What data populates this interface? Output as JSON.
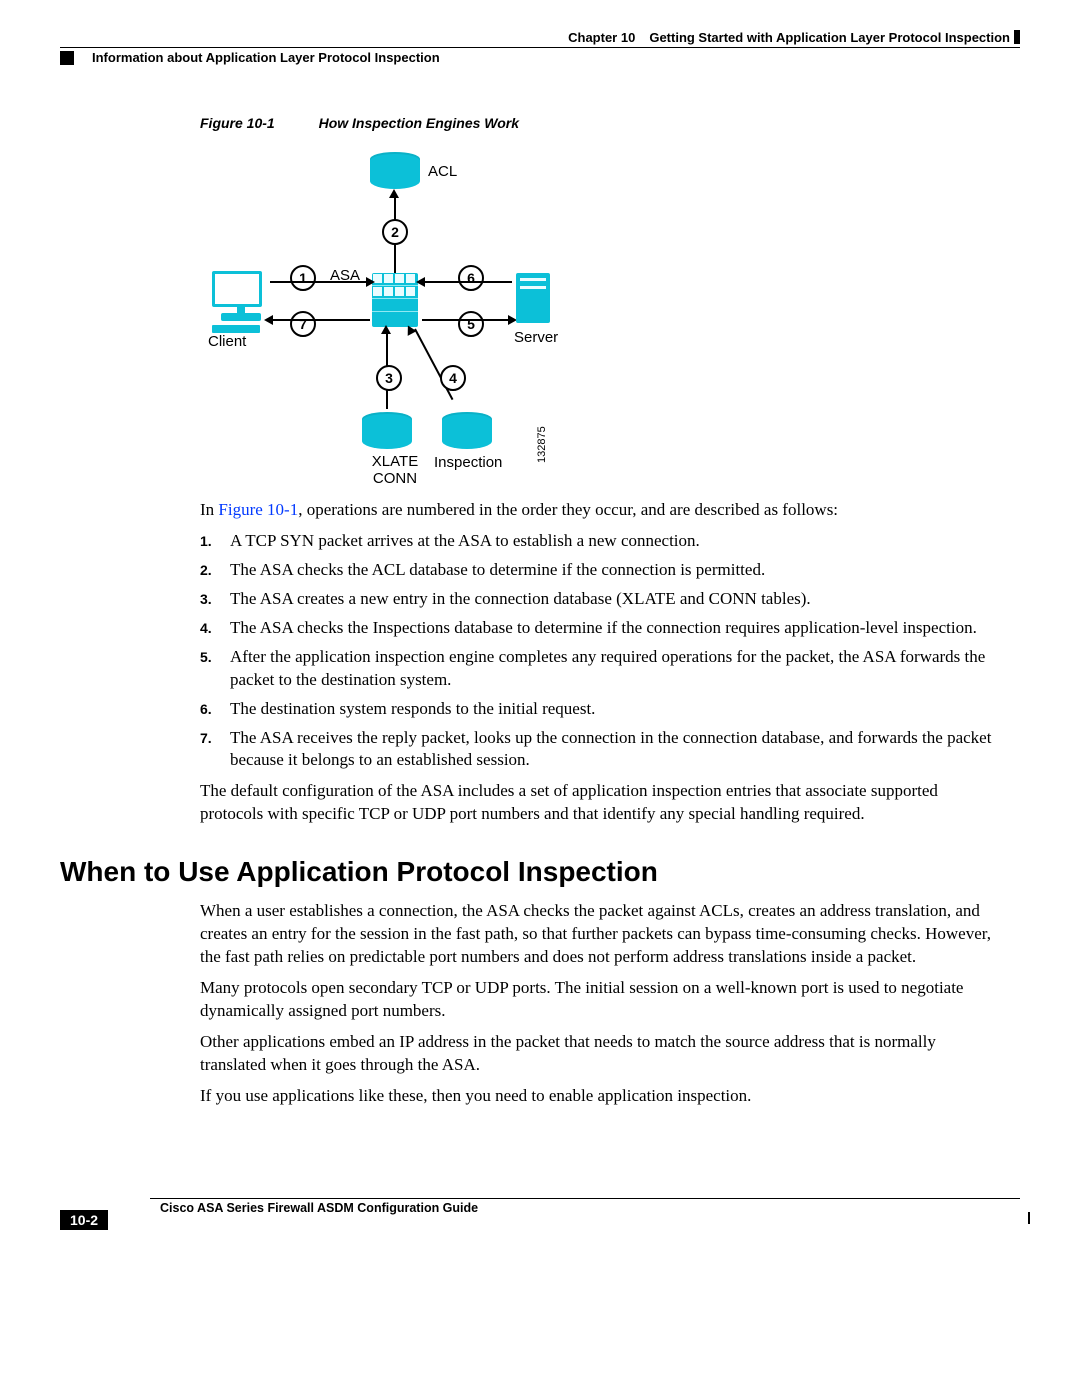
{
  "header": {
    "chapter_label": "Chapter 10",
    "chapter_title": "Getting Started with Application Layer Protocol Inspection",
    "section_header": "Information about Application Layer Protocol Inspection"
  },
  "figure": {
    "label": "Figure 10-1",
    "title": "How Inspection Engines Work",
    "labels": {
      "acl": "ACL",
      "asa": "ASA",
      "client": "Client",
      "server": "Server",
      "xlate_conn": "XLATE CONN",
      "inspection": "Inspection"
    },
    "steps": {
      "s1": "1",
      "s2": "2",
      "s3": "3",
      "s4": "4",
      "s5": "5",
      "s6": "6",
      "s7": "7"
    },
    "image_number": "132875"
  },
  "intro_sentence_prefix": "In ",
  "intro_sentence_ref": "Figure 10-1",
  "intro_sentence_suffix": ", operations are numbered in the order they occur, and are described as follows:",
  "steps_list": [
    {
      "n": "1.",
      "t": "A TCP SYN packet arrives at the ASA to establish a new connection."
    },
    {
      "n": "2.",
      "t": "The ASA checks the ACL database to determine if the connection is permitted."
    },
    {
      "n": "3.",
      "t": "The ASA creates a new entry in the connection database (XLATE and CONN tables)."
    },
    {
      "n": "4.",
      "t": "The ASA checks the Inspections database to determine if the connection requires application-level inspection."
    },
    {
      "n": "5.",
      "t": "After the application inspection engine completes any required operations for the packet, the ASA forwards the packet to the destination system."
    },
    {
      "n": "6.",
      "t": "The destination system responds to the initial request."
    },
    {
      "n": "7.",
      "t": "The ASA receives the reply packet, looks up the connection in the connection database, and forwards the packet because it belongs to an established session."
    }
  ],
  "after_steps_paragraph": "The default configuration of the ASA includes a set of application inspection entries that associate supported protocols with specific TCP or UDP port numbers and that identify any special handling required.",
  "section_heading": "When to Use Application Protocol Inspection",
  "section_paragraphs": [
    "When a user establishes a connection, the ASA checks the packet against ACLs, creates an address translation, and creates an entry for the session in the fast path, so that further packets can bypass time-consuming checks. However, the fast path relies on predictable port numbers and does not perform address translations inside a packet.",
    "Many protocols open secondary TCP or UDP ports. The initial session on a well-known port is used to negotiate dynamically assigned port numbers.",
    "Other applications embed an IP address in the packet that needs to match the source address that is normally translated when it goes through the ASA.",
    "If you use applications like these, then you need to enable application inspection."
  ],
  "footer": {
    "book_title": "Cisco ASA Series Firewall ASDM Configuration Guide",
    "page_number": "10-2"
  }
}
